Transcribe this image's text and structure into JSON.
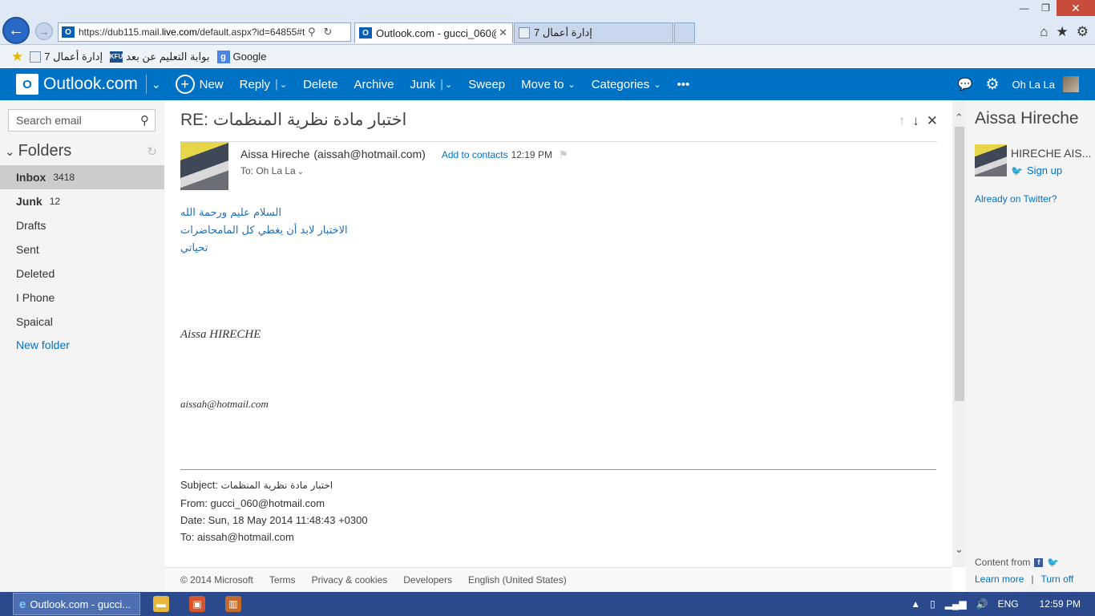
{
  "browser": {
    "address_url_prefix": "https://dub115.mail.",
    "address_url_domain": "live.com",
    "address_url_suffix": "/default.aspx?id=64855#t",
    "tabs": [
      {
        "label": "Outlook.com - gucci_060@...",
        "active": true
      },
      {
        "label": "إدارة أعمال 7",
        "active": false
      }
    ],
    "favorites": [
      {
        "label": "إدارة أعمال 7"
      },
      {
        "label": "بوابة التعليم عن بعد"
      },
      {
        "label": "Google"
      }
    ]
  },
  "outlook": {
    "brand": "Outlook.com",
    "commands": {
      "new": "New",
      "reply": "Reply",
      "delete": "Delete",
      "archive": "Archive",
      "junk": "Junk",
      "sweep": "Sweep",
      "move_to": "Move to",
      "categories": "Categories",
      "more": "•••"
    },
    "user_name": "Oh La La",
    "accent": "#0072c6"
  },
  "leftnav": {
    "search_placeholder": "Search email",
    "folders_title": "Folders",
    "folders": [
      {
        "label": "Inbox",
        "count": "3418"
      },
      {
        "label": "Junk",
        "count": "12"
      },
      {
        "label": "Drafts",
        "count": ""
      },
      {
        "label": "Sent",
        "count": ""
      },
      {
        "label": "Deleted",
        "count": ""
      },
      {
        "label": "I Phone",
        "count": ""
      },
      {
        "label": "Spaical",
        "count": ""
      }
    ],
    "new_folder": "New folder"
  },
  "message": {
    "subject": "RE: اختبار مادة نظرية المنظمات",
    "sender_name": "Aissa Hireche",
    "sender_email": "(aissah@hotmail.com)",
    "add_to_contacts": "Add to contacts",
    "time": "12:19 PM",
    "to": "To: Oh La La",
    "body_lines": [
      "السلام عليم ورحمة الله",
      "الاختبار لابد أن يغطي كل المامحاضرات",
      "تحياتي"
    ],
    "signature_name": "Aissa HIRECHE",
    "signature_email": "aissah@hotmail.com",
    "quoted": {
      "subject_label": "Subject:",
      "subject_value": "اختبار مادة نظرية المنظمات",
      "from": "From: gucci_060@hotmail.com",
      "date": "Date: Sun, 18 May 2014 11:48:43 +0300",
      "to": "To: aissah@hotmail.com"
    }
  },
  "footer": {
    "copyright": "© 2014 Microsoft",
    "terms": "Terms",
    "privacy": "Privacy & cookies",
    "developers": "Developers",
    "language": "English (United States)"
  },
  "rightpane": {
    "contact_name": "Aissa Hireche",
    "profile_label": "HIRECHE AIS...",
    "sign_up": "Sign up",
    "already_twitter": "Already on Twitter?",
    "content_from": "Content from",
    "learn_more": "Learn more",
    "turn_off": "Turn off"
  },
  "taskbar": {
    "active_window": "Outlook.com - gucci...",
    "language": "ENG",
    "clock": "12:59 PM"
  }
}
